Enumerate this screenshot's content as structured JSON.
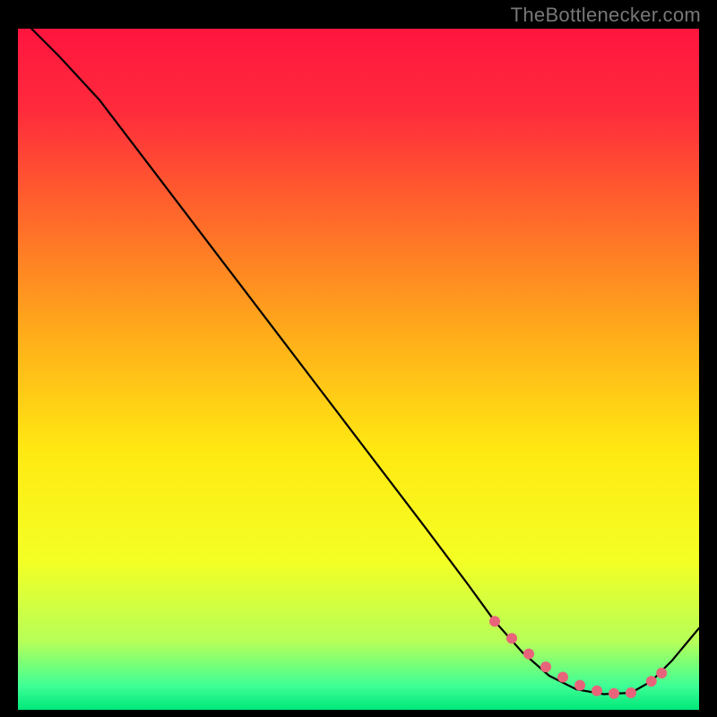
{
  "watermark": "TheBottlenecker.com",
  "chart_data": {
    "type": "line",
    "title": "",
    "xlabel": "",
    "ylabel": "",
    "xlim": [
      0,
      100
    ],
    "ylim": [
      0,
      100
    ],
    "gradient_stops": [
      {
        "offset": 0,
        "color": "#ff153f"
      },
      {
        "offset": 0.12,
        "color": "#ff2b3c"
      },
      {
        "offset": 0.28,
        "color": "#ff6a2a"
      },
      {
        "offset": 0.45,
        "color": "#ffad1a"
      },
      {
        "offset": 0.62,
        "color": "#ffe912"
      },
      {
        "offset": 0.78,
        "color": "#f4ff24"
      },
      {
        "offset": 0.9,
        "color": "#b6ff58"
      },
      {
        "offset": 0.965,
        "color": "#3eff96"
      },
      {
        "offset": 1.0,
        "color": "#00e77a"
      }
    ],
    "series": [
      {
        "name": "curve",
        "color": "#000000",
        "stroke_width": 2.2,
        "x": [
          2,
          6,
          12,
          20,
          28,
          36,
          44,
          52,
          60,
          66,
          70,
          74,
          78,
          82,
          86,
          90,
          93,
          96,
          100
        ],
        "y": [
          100,
          96,
          89.5,
          79,
          68.5,
          58,
          47.5,
          37,
          26.5,
          18.5,
          13,
          8.5,
          5,
          3,
          2.3,
          2.5,
          4.2,
          7.2,
          12
        ]
      }
    ],
    "markers": {
      "name": "highlight-dots",
      "color": "#e8647a",
      "radius": 6,
      "x": [
        70,
        72.5,
        75,
        77.5,
        80,
        82.5,
        85,
        87.5,
        90,
        93,
        94.5
      ],
      "y": [
        13,
        10.5,
        8.2,
        6.3,
        4.8,
        3.6,
        2.8,
        2.4,
        2.5,
        4.2,
        5.4
      ]
    }
  }
}
